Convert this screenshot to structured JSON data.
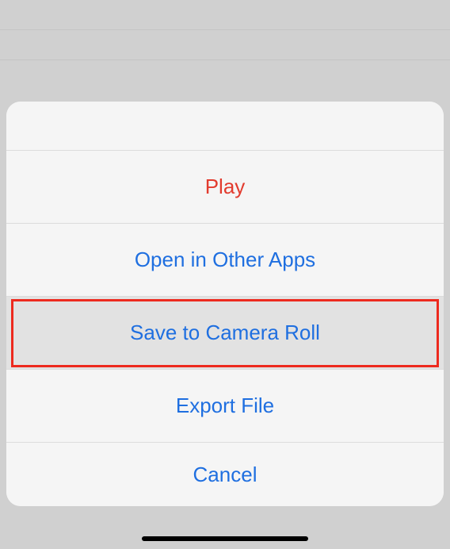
{
  "actionSheet": {
    "items": [
      {
        "label": "Play",
        "style": "red",
        "highlighted": false
      },
      {
        "label": "Open in Other Apps",
        "style": "blue",
        "highlighted": false
      },
      {
        "label": "Save to Camera Roll",
        "style": "blue",
        "highlighted": true
      },
      {
        "label": "Export File",
        "style": "blue",
        "highlighted": false
      }
    ],
    "cancel": "Cancel"
  },
  "annotation": {
    "highlightColor": "#ed2a1f"
  },
  "colors": {
    "blue": "#1f6fe0",
    "red": "#e23b2e",
    "background": "#d0d0d0",
    "sheet": "#f5f5f5"
  }
}
